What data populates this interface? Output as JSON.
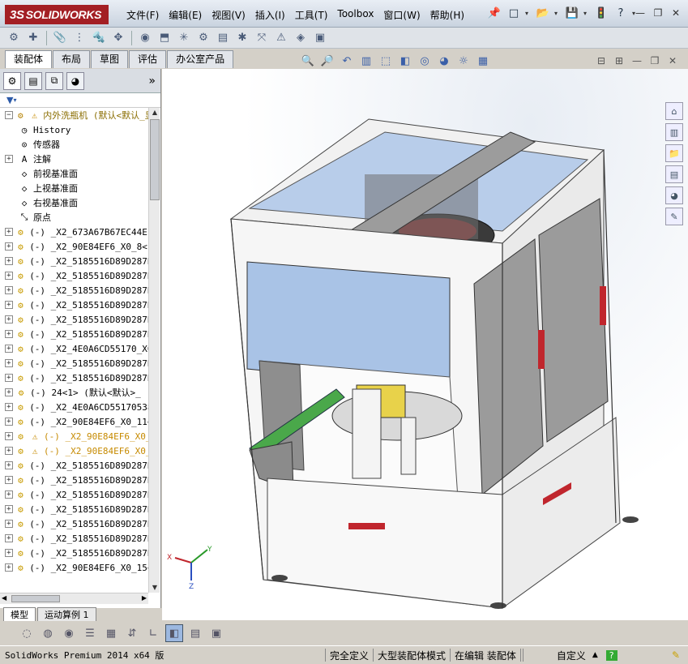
{
  "app": {
    "logo": "SOLIDWORKS",
    "logo_ds": "3S"
  },
  "menu": [
    "文件(F)",
    "编辑(E)",
    "视图(V)",
    "插入(I)",
    "工具(T)",
    "Toolbox",
    "窗口(W)",
    "帮助(H)"
  ],
  "command_tabs": [
    "装配体",
    "布局",
    "草图",
    "评估",
    "办公室产品"
  ],
  "tree": {
    "root": "内外洗瓶机  (默认<默认_显",
    "fixed_items": [
      {
        "label": "History",
        "icon": "history-icon"
      },
      {
        "label": "传感器",
        "icon": "sensor-icon"
      },
      {
        "label": "注解",
        "icon": "annotation-icon",
        "expand": true
      },
      {
        "label": "前视基准面",
        "icon": "plane-icon"
      },
      {
        "label": "上视基准面",
        "icon": "plane-icon"
      },
      {
        "label": "右视基准面",
        "icon": "plane-icon"
      },
      {
        "label": "原点",
        "icon": "origin-icon"
      }
    ],
    "components": [
      {
        "label": "(-) _X2_673A67B67EC44EF",
        "warn": false
      },
      {
        "label": "(-) _X2_90E84EF6_X0_8<1",
        "warn": false
      },
      {
        "label": "(-) _X2_5185516D89D287B",
        "warn": false
      },
      {
        "label": "(-) _X2_5185516D89D287B",
        "warn": false
      },
      {
        "label": "(-) _X2_5185516D89D287B",
        "warn": false
      },
      {
        "label": "(-) _X2_5185516D89D287B",
        "warn": false
      },
      {
        "label": "(-) _X2_5185516D89D287B",
        "warn": false
      },
      {
        "label": "(-) _X2_5185516D89D287B",
        "warn": false
      },
      {
        "label": "(-) _X2_4E0A6CD55170_X0",
        "warn": false
      },
      {
        "label": "(-) _X2_5185516D89D287B",
        "warn": false
      },
      {
        "label": "(-) _X2_5185516D89D287B",
        "warn": false
      },
      {
        "label": "(-) 24<1> (默认<默认>_",
        "warn": false
      },
      {
        "label": "(-) _X2_4E0A6CD55170538",
        "warn": false
      },
      {
        "label": "(-) _X2_90E84EF6_X0_11<",
        "warn": false
      },
      {
        "label": "(-) _X2_90E84EF6_X0_",
        "warn": true
      },
      {
        "label": "(-) _X2_90E84EF6_X0_",
        "warn": true
      },
      {
        "label": "(-) _X2_5185516D89D287B",
        "warn": false
      },
      {
        "label": "(-) _X2_5185516D89D287B",
        "warn": false
      },
      {
        "label": "(-) _X2_5185516D89D287B",
        "warn": false
      },
      {
        "label": "(-) _X2_5185516D89D287B",
        "warn": false
      },
      {
        "label": "(-) _X2_5185516D89D287B",
        "warn": false
      },
      {
        "label": "(-) _X2_5185516D89D287B",
        "warn": false
      },
      {
        "label": "(-) _X2_5185516D89D287B",
        "warn": false
      },
      {
        "label": "(-) _X2_90E84EF6_X0_15<",
        "warn": false
      }
    ]
  },
  "bottom_tabs": [
    "模型",
    "运动算例 1"
  ],
  "status": {
    "product": "SolidWorks Premium 2014 x64 版",
    "state": "完全定义",
    "mode": "大型装配体模式",
    "editing": "在编辑 装配体",
    "units": "自定义"
  },
  "triad": {
    "x": "X",
    "y": "Y",
    "z": "Z"
  },
  "colors": {
    "accent": "#a31f24",
    "model_blue": "#a9c3e6",
    "model_frame": "#e9e9e9",
    "model_panel": "#9a9a9a",
    "handle": "#c0262d"
  }
}
